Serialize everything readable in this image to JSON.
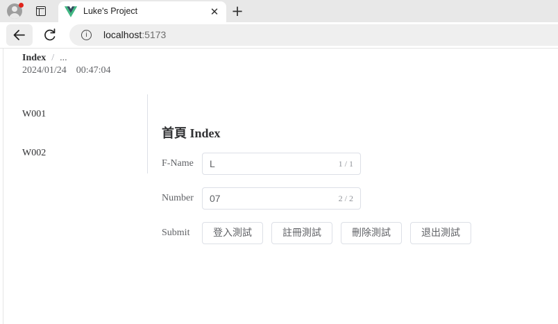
{
  "browser": {
    "tab_title": "Luke's Project",
    "close_glyph": "✕",
    "new_tab_glyph": "+",
    "url_host": "localhost",
    "url_port": ":5173",
    "icons": [
      "profile-avatar-icon",
      "tab-actions-icon",
      "vue-logo-icon",
      "close-icon",
      "plus-icon",
      "back-arrow-icon",
      "reload-icon",
      "info-icon"
    ],
    "colors": {
      "vue_green": "#41b883",
      "vue_dark": "#35495e",
      "notification_dot": "#e0241b"
    }
  },
  "page": {
    "breadcrumb": {
      "current": "Index",
      "separator": "/",
      "more": "..."
    },
    "date": "2024/01/24",
    "time": "00:47:04",
    "menu": [
      {
        "label": "W001"
      },
      {
        "label": "W002"
      }
    ],
    "heading": "首頁 Index",
    "form": {
      "fname": {
        "label": "F-Name",
        "value": "L",
        "count": "1 / 1"
      },
      "number": {
        "label": "Number",
        "value": "07",
        "count": "2 / 2"
      },
      "submit": {
        "label": "Submit",
        "buttons": [
          "登入測試",
          "註冊測試",
          "刪除測試",
          "退出測試"
        ]
      }
    }
  }
}
